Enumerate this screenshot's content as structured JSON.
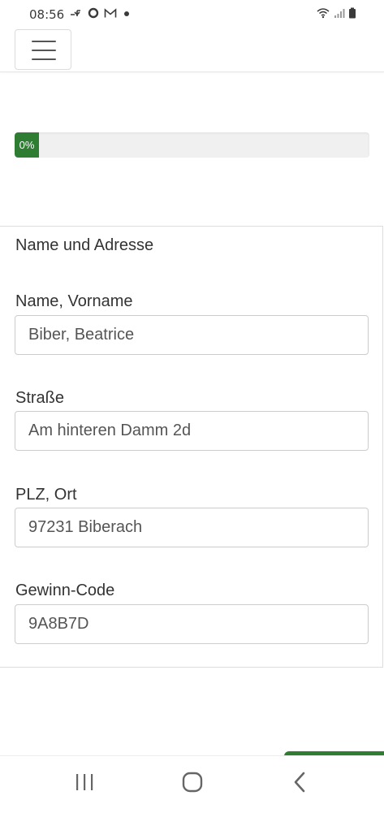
{
  "status_bar": {
    "time": "08:56",
    "left_icons": [
      "missed-call-icon",
      "circle-o-icon",
      "gmail-icon",
      "dot-icon"
    ],
    "right_icons": [
      "wifi-icon",
      "signal-icon",
      "battery-icon"
    ]
  },
  "navbar": {
    "menu_icon": "hamburger-menu-icon"
  },
  "progress": {
    "label": "0%",
    "value": 0,
    "color": "#2e7d32"
  },
  "form": {
    "heading": "Name und Adresse",
    "fields": [
      {
        "label": "Name, Vorname",
        "value": "Biber, Beatrice"
      },
      {
        "label": "Straße",
        "value": "Am hinteren Damm 2d"
      },
      {
        "label": "PLZ, Ort",
        "value": "97231 Biberach"
      },
      {
        "label": "Gewinn-Code",
        "value": "9A8B7D"
      }
    ]
  },
  "system_nav": {
    "buttons": [
      "recent-apps-icon",
      "home-icon",
      "back-icon"
    ]
  },
  "colors": {
    "accent": "#2e7d32",
    "border": "#cccccc",
    "text": "#333333"
  }
}
